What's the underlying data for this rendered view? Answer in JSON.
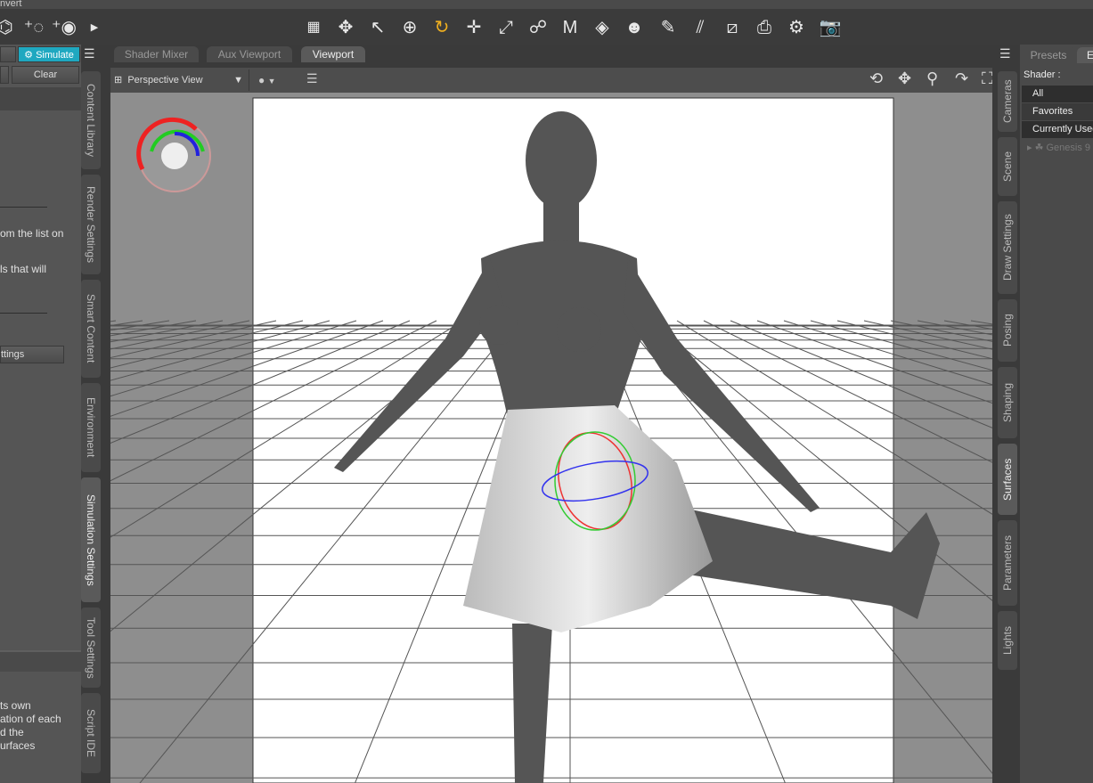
{
  "menubar": {
    "visible_text": "nvert"
  },
  "toolbar": {
    "icons": [
      "add-figure-icon",
      "add-null-icon",
      "add-light-icon",
      "expand-arrow-icon",
      "grid-icon",
      "universal-tool-icon",
      "select-tool-icon",
      "node-weight-icon",
      "rotate-tool-icon",
      "translate-tool-icon",
      "scale-tool-icon",
      "joint-editor-icon",
      "geometry-editor-icon",
      "surface-selection-icon",
      "region-navigator-icon",
      "active-pose-icon",
      "weight-map-brush-icon",
      "geometry-sculptor-icon",
      "edit-icon",
      "spot-render-icon",
      "tool-settings-icon",
      "render-icon"
    ]
  },
  "left_panel": {
    "simulate_label": "Simulate",
    "clear_label": "Clear",
    "text_lines_1": [
      "om the list on",
      "ls that will"
    ],
    "settings_button": "ttings",
    "text_lines_2": [
      "ts own",
      "ation of each",
      "d the",
      "urfaces"
    ],
    "accent": "#1fa8c0"
  },
  "left_tabs": [
    "Content Library",
    "Render Settings",
    "Smart Content",
    "Environment",
    "Simulation Settings",
    "Tool Settings",
    "Script IDE"
  ],
  "viewport_tabs": [
    "Shader Mixer",
    "Aux Viewport",
    "Viewport"
  ],
  "viewport": {
    "camera": "Perspective View"
  },
  "right_tabs": [
    "Cameras",
    "Scene",
    "Draw Settings",
    "Posing",
    "Shaping",
    "Surfaces",
    "Parameters",
    "Lights"
  ],
  "right_panel": {
    "tabs": [
      "Presets",
      "E"
    ],
    "shader_label": "Shader :",
    "items": [
      "All",
      "Favorites",
      "Currently Used"
    ],
    "tree_item": "Genesis 9"
  }
}
